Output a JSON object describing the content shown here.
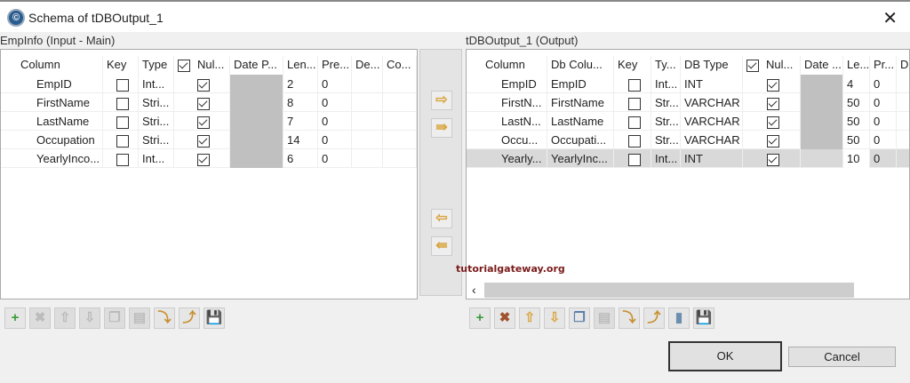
{
  "window": {
    "title": "Schema of tDBOutput_1",
    "close": "✕"
  },
  "left": {
    "label": "EmpInfo (Input - Main)",
    "headers": [
      "Column",
      "Key",
      "Type",
      "Nul...",
      "Date P...",
      "Len...",
      "Pre...",
      "De...",
      "Co..."
    ],
    "rows": [
      {
        "column": "EmpID",
        "key": false,
        "type": "Int...",
        "nullable": true,
        "length": "2",
        "precision": "0"
      },
      {
        "column": "FirstName",
        "key": false,
        "type": "Stri...",
        "nullable": true,
        "length": "8",
        "precision": "0"
      },
      {
        "column": "LastName",
        "key": false,
        "type": "Stri...",
        "nullable": true,
        "length": "7",
        "precision": "0"
      },
      {
        "column": "Occupation",
        "key": false,
        "type": "Stri...",
        "nullable": true,
        "length": "14",
        "precision": "0"
      },
      {
        "column": "YearlyInco...",
        "key": false,
        "type": "Int...",
        "nullable": true,
        "length": "6",
        "precision": "0"
      }
    ]
  },
  "right": {
    "label": "tDBOutput_1 (Output)",
    "headers": [
      "Column",
      "Db Colu...",
      "Key",
      "Ty...",
      "DB Type",
      "Nul...",
      "Date ...",
      "Le...",
      "Pr...",
      "D"
    ],
    "rows": [
      {
        "column": "EmpID",
        "db_column": "EmpID",
        "key": false,
        "type": "Int...",
        "db_type": "INT",
        "nullable": true,
        "length": "4",
        "precision": "0"
      },
      {
        "column": "FirstN...",
        "db_column": "FirstName",
        "key": false,
        "type": "Str...",
        "db_type": "VARCHAR",
        "nullable": true,
        "length": "50",
        "precision": "0"
      },
      {
        "column": "LastN...",
        "db_column": "LastName",
        "key": false,
        "type": "Str...",
        "db_type": "VARCHAR",
        "nullable": true,
        "length": "50",
        "precision": "0"
      },
      {
        "column": "Occu...",
        "db_column": "Occupati...",
        "key": false,
        "type": "Str...",
        "db_type": "VARCHAR",
        "nullable": true,
        "length": "50",
        "precision": "0"
      },
      {
        "column": "Yearly...",
        "db_column": "YearlyInc...",
        "key": false,
        "type": "Int...",
        "db_type": "INT",
        "nullable": true,
        "length": "10",
        "precision": "0"
      }
    ],
    "scroll_left": "‹"
  },
  "arrows": {
    "copy_one": "⇨",
    "copy_all": "⇛",
    "back_one": "⇦",
    "back_all": "⇚"
  },
  "toolbar_icons": {
    "add": "+",
    "remove": "✖",
    "up": "⇧",
    "down": "⇩",
    "copy": "❐",
    "paste": "▤",
    "import": "⤵",
    "export": "⤴",
    "db": "▮",
    "save": "💾"
  },
  "watermark": "tutorialgateway.org",
  "buttons": {
    "ok": "OK",
    "cancel": "Cancel"
  }
}
